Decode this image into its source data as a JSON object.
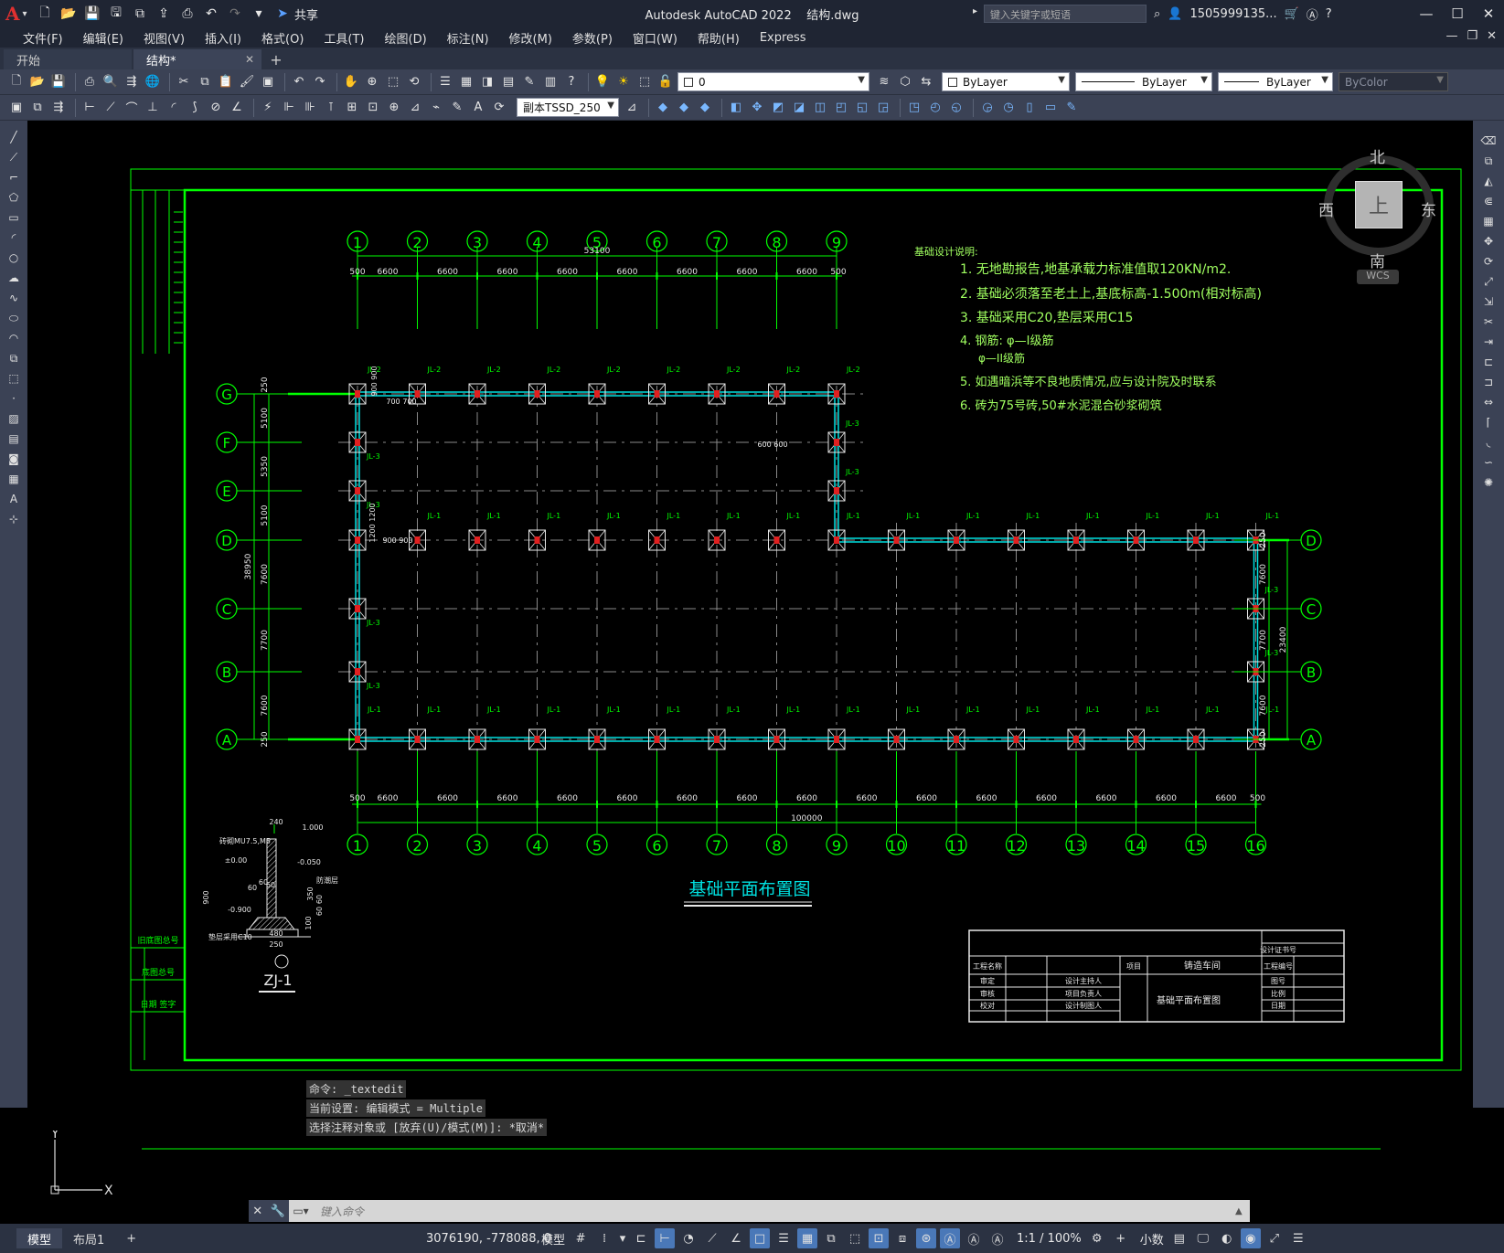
{
  "app": {
    "title": "Autodesk AutoCAD 2022",
    "file": "结构.dwg",
    "logo": "A",
    "share_label": "共享",
    "search_placeholder": "键入关键字或短语",
    "user": "1505999135...",
    "accent_color": "#00ff00"
  },
  "menu": [
    "文件(F)",
    "编辑(E)",
    "视图(V)",
    "插入(I)",
    "格式(O)",
    "工具(T)",
    "绘图(D)",
    "标注(N)",
    "修改(M)",
    "参数(P)",
    "窗口(W)",
    "帮助(H)",
    "Express"
  ],
  "tabs": [
    {
      "label": "开始"
    },
    {
      "label": "结构*"
    }
  ],
  "toolbar": {
    "layer_value": "0",
    "color_value": "ByLayer",
    "linetype_value": "ByLayer",
    "lineweight_value": "ByLayer",
    "plotstyle_value": "ByColor",
    "dimstyle_value": "副本TSSD_250"
  },
  "viewcube": {
    "north": "北",
    "south": "南",
    "east": "东",
    "west": "西",
    "top": "上",
    "wcs": "WCS"
  },
  "drawing": {
    "title": "基础平面布置图",
    "notes_title": "基础设计说明:",
    "notes": [
      "1. 无地勘报告,地基承载力标准值取120KN/m2.",
      "2. 基础必须落至老土上,基底标高-1.500m(相对标高)",
      "3. 基础采用C20,垫层采用C15",
      "4. 钢筋: φ—I级筋",
      "φ—II级筋",
      "5. 如遇暗浜等不良地质情况,应与设计院及时联系",
      "6. 砖为75号砖,50#水泥混合砂浆砌筑"
    ],
    "top_total": "53100",
    "bottom_total": "100000",
    "left_total": "38950",
    "right_total": "23400",
    "bay": "6600",
    "edge": "500",
    "left_dims": [
      "250",
      "5100",
      "5350",
      "5100",
      "7600",
      "7700",
      "7600",
      "250"
    ],
    "right_dims": [
      "250",
      "7600",
      "7700",
      "7600",
      "250"
    ],
    "cols_top": [
      "1",
      "2",
      "3",
      "4",
      "5",
      "6",
      "7",
      "8",
      "9"
    ],
    "cols_bottom": [
      "1",
      "2",
      "3",
      "4",
      "5",
      "6",
      "7",
      "8",
      "9",
      "10",
      "11",
      "12",
      "13",
      "14",
      "15",
      "16"
    ],
    "rows_left": [
      "G",
      "F",
      "E",
      "D",
      "C",
      "B",
      "A"
    ],
    "rows_right": [
      "D",
      "C",
      "B",
      "A"
    ],
    "jl1": "JL-1",
    "jl2": "JL-2",
    "jl3": "JL-3",
    "detail": {
      "name": "ZJ-1",
      "dims": [
        "240",
        "1.000",
        "±0.00",
        "-0.050",
        "-0.900",
        "900",
        "60",
        "60",
        "480",
        "250",
        "60",
        "100",
        "60",
        "60",
        "350"
      ],
      "labels": [
        "砖砌MU7.5,M5",
        "防潮层",
        "垫层采用C10"
      ]
    },
    "small_dims": [
      "700",
      "700",
      "900 900",
      "1200 1200",
      "900 900",
      "600 600"
    ],
    "title_block": {
      "project_name_label": "工程名称",
      "project_label": "项目",
      "project_value": "铸造车间",
      "drawing_name": "基础平面布置图",
      "approve": "审定",
      "review": "审核",
      "check": "校对",
      "lead_designer": "设计主持人",
      "project_lead": "项目负责人",
      "drafter": "设计制图人",
      "cert": "设计证书号",
      "project_no": "工程编号",
      "drawing_no": "图号",
      "scale": "比例",
      "date": "日期"
    },
    "side_labels": [
      "旧底图总号",
      "底图总号",
      "日期 签字"
    ]
  },
  "command": {
    "history": [
      "命令: _textedit",
      "当前设置: 编辑模式 = Multiple",
      "选择注释对象或 [放弃(U)/模式(M)]: *取消*"
    ],
    "placeholder": "键入命令"
  },
  "status": {
    "layout_tabs": [
      "模型",
      "布局1"
    ],
    "coords": "3076190, -778088, 0",
    "model_label": "模型",
    "scale": "1:1 / 100%",
    "units": "小数"
  }
}
